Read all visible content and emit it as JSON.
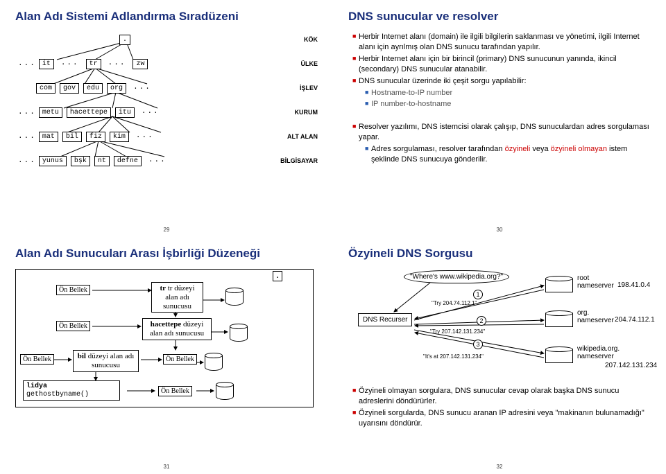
{
  "slide29": {
    "title": "Alan Adı Sistemi Adlandırma Sıradüzeni",
    "levels": [
      "KÖK",
      "ÜLKE",
      "İŞLEV",
      "KURUM",
      "ALT ALAN",
      "BİLGİSAYAR"
    ],
    "rows": [
      {
        "pre": "",
        "nodes": [
          "."
        ],
        "post": ""
      },
      {
        "pre": "...",
        "nodes": [
          "it",
          "tr",
          "zw"
        ],
        "post": ""
      },
      {
        "pre": "",
        "nodes": [
          "com",
          "gov",
          "edu",
          "org"
        ],
        "post": "..."
      },
      {
        "pre": "...",
        "nodes": [
          "metu",
          "hacettepe",
          "itu"
        ],
        "post": "..."
      },
      {
        "pre": "...",
        "nodes": [
          "mat",
          "bil",
          "fiz",
          "kim"
        ],
        "post": "..."
      },
      {
        "pre": "...",
        "nodes": [
          "yunus",
          "bşk",
          "nt",
          "defne"
        ],
        "post": "..."
      }
    ],
    "page": "29"
  },
  "slide30": {
    "title": "DNS sunucular ve resolver",
    "b1": "Herbir Internet alanı (domain) ile ilgili bilgilerin saklanması ve yönetimi, ilgili Internet alanı için ayrılmış olan DNS sunucu tarafından yapılır.",
    "b2": "Herbir Internet alanı için bir birincil (primary) DNS sunucunun yanında, ikincil (secondary) DNS sunucular atanabilir.",
    "b3": "DNS sunucular üzerinde iki çeşit sorgu yapılabilir:",
    "b3a": "Hostname-to-IP number",
    "b3b": "IP number-to-hostname",
    "b4": "Resolver yazılımı, DNS istemcisi olarak çalışıp, DNS sunuculardan adres sorgulaması yapar.",
    "b5_pre": "Adres sorgulaması, resolver tarafından ",
    "b5_oz1": "özyineli",
    "b5_mid": " veya ",
    "b5_oz2": "özyineli olmayan",
    "b5_post": " istem şeklinde DNS sunucuya gönderilir.",
    "page": "30"
  },
  "slide31": {
    "title": "Alan Adı Sunucuları Arası İşbirliği Düzeneği",
    "root_dot": ".",
    "cache": "Ön Bellek",
    "srv_tr": "tr düzeyi alan adı sunucusu",
    "srv_hu": "hacettepe düzeyi alan adı sunucusu",
    "srv_bil": "bil düzeyi alan adı sunucusu",
    "client": "lidya",
    "call": "gethostbyname()",
    "page": "31"
  },
  "slide32": {
    "title": "Özyineli DNS Sorgusu",
    "bubble": "\"Where's www.wikipedia.org?\"",
    "recurser": "DNS Recurser",
    "ns_root": "root\nnameserver",
    "ns_org": "org.\nnameserver",
    "ns_wiki": "wikipedia.org.\nnameserver",
    "ip_root": "198.41.0.4",
    "ip_org": "204.74.112.1",
    "ip_wiki": "207.142.131.234",
    "r1": "\"Try 204.74.112.1\"",
    "r2": "\"Try 207.142.131.234\"",
    "r3": "\"It's at 207.142.131.234\"",
    "b1": "Özyineli olmayan sorgulara, DNS sunucular cevap olarak başka DNS sunucu adreslerini döndürürler.",
    "b2": "Özyineli sorgularda, DNS sunucu aranan IP adresini veya \"makinanın bulunamadığı\" uyarısını döndürür.",
    "page": "32"
  }
}
